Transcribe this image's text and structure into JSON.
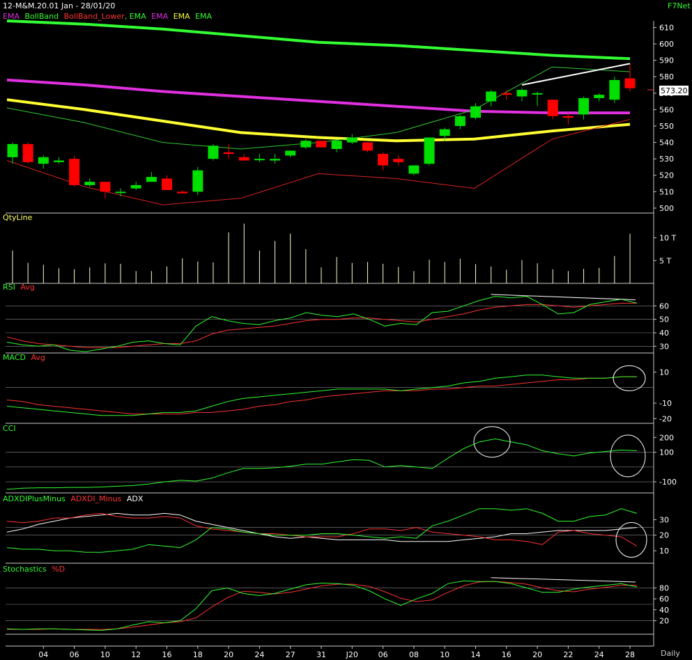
{
  "header": {
    "title": "12-M&M.20.01 Jan - 28/01/20",
    "brand": "F7Net",
    "timeframe": "Daily"
  },
  "colors": {
    "bullish": "#00e000",
    "bearish": "#ff0000",
    "ema_long": "#33ff33",
    "ema_mid": "#e030e0",
    "ema_short": "#ffff33",
    "boll_upper": "#33cc33",
    "boll_lower": "#dd2222",
    "volume": "#ffffcc",
    "grid": "#888888"
  },
  "chart_data": [
    {
      "type": "candlestick",
      "panel": "price",
      "legend": [
        "EMA",
        "BollBand",
        "BollBand_Lower",
        "EMA",
        "EMA",
        "EMA",
        "EMA"
      ],
      "y_ticks": [
        500,
        510,
        520,
        530,
        540,
        550,
        560,
        570,
        580,
        590,
        600,
        610
      ],
      "ylim": [
        497,
        614
      ],
      "last_price": "573.20",
      "x_ticks": [
        "04",
        "06",
        "10",
        "12",
        "16",
        "18",
        "20",
        "24",
        "27",
        "31",
        "J20",
        "06",
        "08",
        "10",
        "14",
        "16",
        "20",
        "22",
        "24",
        "28"
      ],
      "candles": [
        {
          "o": 531,
          "h": 540,
          "l": 527,
          "c": 539
        },
        {
          "o": 539,
          "h": 540,
          "l": 527,
          "c": 528
        },
        {
          "o": 527,
          "h": 532,
          "l": 524,
          "c": 531
        },
        {
          "o": 528,
          "h": 531,
          "l": 527,
          "c": 529
        },
        {
          "o": 530,
          "h": 532,
          "l": 513,
          "c": 514
        },
        {
          "o": 514,
          "h": 518,
          "l": 513,
          "c": 516
        },
        {
          "o": 516,
          "h": 516,
          "l": 506,
          "c": 510
        },
        {
          "o": 510,
          "h": 512,
          "l": 507,
          "c": 510
        },
        {
          "o": 512,
          "h": 516,
          "l": 511,
          "c": 514
        },
        {
          "o": 516,
          "h": 522,
          "l": 516,
          "c": 519
        },
        {
          "o": 518,
          "h": 520,
          "l": 511,
          "c": 511
        },
        {
          "o": 510,
          "h": 511,
          "l": 509,
          "c": 509
        },
        {
          "o": 510,
          "h": 525,
          "l": 508,
          "c": 523
        },
        {
          "o": 530,
          "h": 539,
          "l": 529,
          "c": 538
        },
        {
          "o": 534,
          "h": 539,
          "l": 530,
          "c": 533
        },
        {
          "o": 531,
          "h": 533,
          "l": 529,
          "c": 529
        },
        {
          "o": 530,
          "h": 533,
          "l": 528,
          "c": 530
        },
        {
          "o": 529,
          "h": 533,
          "l": 527,
          "c": 530
        },
        {
          "o": 532,
          "h": 535,
          "l": 531,
          "c": 535
        },
        {
          "o": 537,
          "h": 542,
          "l": 536,
          "c": 541
        },
        {
          "o": 541,
          "h": 541,
          "l": 537,
          "c": 537
        },
        {
          "o": 536,
          "h": 541,
          "l": 534,
          "c": 541
        },
        {
          "o": 540,
          "h": 545,
          "l": 539,
          "c": 543
        },
        {
          "o": 540,
          "h": 540,
          "l": 534,
          "c": 535
        },
        {
          "o": 533,
          "h": 534,
          "l": 523,
          "c": 526
        },
        {
          "o": 530,
          "h": 532,
          "l": 526,
          "c": 528
        },
        {
          "o": 521,
          "h": 526,
          "l": 520,
          "c": 526
        },
        {
          "o": 527,
          "h": 543,
          "l": 526,
          "c": 543
        },
        {
          "o": 544,
          "h": 549,
          "l": 541,
          "c": 548
        },
        {
          "o": 550,
          "h": 557,
          "l": 548,
          "c": 556
        },
        {
          "o": 555,
          "h": 564,
          "l": 554,
          "c": 562
        },
        {
          "o": 565,
          "h": 572,
          "l": 562,
          "c": 571
        },
        {
          "o": 570,
          "h": 572,
          "l": 566,
          "c": 569
        },
        {
          "o": 568,
          "h": 573,
          "l": 565,
          "c": 572
        },
        {
          "o": 570,
          "h": 571,
          "l": 562,
          "c": 570
        },
        {
          "o": 566,
          "h": 566,
          "l": 554,
          "c": 556
        },
        {
          "o": 556,
          "h": 558,
          "l": 551,
          "c": 555
        },
        {
          "o": 557,
          "h": 568,
          "l": 554,
          "c": 567
        },
        {
          "o": 567,
          "h": 570,
          "l": 565,
          "c": 569
        },
        {
          "o": 566,
          "h": 580,
          "l": 564,
          "c": 578
        },
        {
          "o": 579,
          "h": 588,
          "l": 571,
          "c": 573
        }
      ],
      "ema_long": [
        614,
        612,
        609,
        605,
        601,
        599,
        596,
        593,
        591
      ],
      "ema_mid": [
        578,
        575,
        571,
        568,
        565,
        562,
        559,
        558,
        558
      ],
      "ema_short": [
        566,
        560,
        553,
        546,
        543,
        541,
        542,
        547,
        551
      ],
      "boll_upper": [
        561,
        552,
        540,
        536,
        540,
        546,
        560,
        586,
        583
      ],
      "boll_lower": [
        529,
        513,
        502,
        506,
        521,
        518,
        512,
        542,
        554
      ],
      "trendline": {
        "from": 575,
        "to": 588
      }
    },
    {
      "type": "bar",
      "panel": "volume",
      "legend": [
        "QtyLine"
      ],
      "y_ticks": [
        "5 T",
        "10 T"
      ],
      "values": [
        7.2,
        4.5,
        4.1,
        3.3,
        3.1,
        3.5,
        4.4,
        4.3,
        2.7,
        2.7,
        3.7,
        5.5,
        4.8,
        4.6,
        11.2,
        13.1,
        7.2,
        9.3,
        10.9,
        7.5,
        3.5,
        5.8,
        4.5,
        4.7,
        4.3,
        3.6,
        2.7,
        5.2,
        4.7,
        5.4,
        4.2,
        3.7,
        3.0,
        5.1,
        4.4,
        3.1,
        2.7,
        3.2,
        3.4,
        6.0,
        10.9
      ],
      "ylim": [
        0,
        13.3
      ]
    },
    {
      "type": "line",
      "panel": "rsi",
      "legend": [
        "RSI",
        "Avg"
      ],
      "y_ticks": [
        30,
        40,
        50,
        60
      ],
      "ylim": [
        25,
        70
      ],
      "rsi": [
        33,
        31,
        30,
        31,
        27,
        26,
        28,
        30,
        33,
        34,
        32,
        31,
        45,
        52,
        49,
        47,
        46,
        49,
        51,
        55,
        53,
        52,
        54,
        50,
        45,
        47,
        46,
        55,
        56,
        60,
        64,
        67,
        66,
        67,
        61,
        54,
        55,
        61,
        63,
        65,
        62
      ],
      "avg": [
        37,
        34,
        32,
        31,
        30,
        29,
        29,
        29,
        30,
        31,
        32,
        32,
        34,
        39,
        42,
        43,
        44,
        45,
        47,
        49,
        50,
        50,
        51,
        51,
        50,
        49,
        48,
        50,
        52,
        54,
        57,
        59,
        60,
        61,
        61,
        60,
        59,
        60,
        61,
        62,
        62
      ]
    },
    {
      "type": "line",
      "panel": "macd",
      "legend": [
        "MACD",
        "Avg"
      ],
      "y_ticks": [
        -20,
        -10,
        10
      ],
      "ylim": [
        -23,
        16
      ],
      "macd": [
        -12,
        -13,
        -14,
        -15,
        -16,
        -17,
        -18,
        -18,
        -18,
        -17,
        -16,
        -16,
        -15,
        -12,
        -9,
        -7,
        -6,
        -5,
        -4,
        -3,
        -2,
        -1,
        -1,
        -1,
        -1,
        -2,
        -1,
        0,
        1,
        3,
        4,
        6,
        7,
        8,
        8,
        7,
        6,
        6,
        6,
        7,
        7
      ],
      "avg": [
        -8,
        -9,
        -11,
        -12,
        -13,
        -14,
        -15,
        -16,
        -17,
        -17,
        -17,
        -17,
        -16,
        -16,
        -15,
        -14,
        -12,
        -11,
        -9,
        -8,
        -6,
        -5,
        -4,
        -3,
        -2,
        -2,
        -2,
        -1,
        -1,
        0,
        1,
        1,
        2,
        3,
        4,
        5,
        5,
        6,
        6,
        7,
        7
      ]
    },
    {
      "type": "line",
      "panel": "cci",
      "legend": [
        "CCI"
      ],
      "y_ticks": [
        -100,
        100,
        200
      ],
      "ylim": [
        -175,
        225
      ],
      "cci": [
        -150,
        -143,
        -140,
        -140,
        -138,
        -138,
        -135,
        -130,
        -125,
        -115,
        -100,
        -90,
        -95,
        -75,
        -40,
        -10,
        -10,
        -5,
        5,
        20,
        20,
        35,
        50,
        45,
        0,
        10,
        0,
        -10,
        60,
        125,
        170,
        190,
        170,
        150,
        110,
        90,
        75,
        95,
        105,
        115,
        110
      ]
    },
    {
      "type": "line",
      "panel": "adx",
      "legend": [
        "ADXDIPlusMinus",
        "ADXDI_Minus",
        "ADX"
      ],
      "y_ticks": [
        10,
        20,
        30
      ],
      "ylim": [
        2,
        40
      ],
      "di_plus": [
        12,
        11,
        11,
        10,
        10,
        9,
        9,
        10,
        11,
        14,
        13,
        12,
        17,
        25,
        24,
        22,
        21,
        20,
        20,
        20,
        21,
        21,
        20,
        19,
        18,
        19,
        18,
        26,
        29,
        33,
        37,
        37,
        36,
        37,
        34,
        29,
        29,
        32,
        33,
        37,
        34
      ],
      "di_minus": [
        29,
        28,
        29,
        31,
        31,
        33,
        34,
        32,
        31,
        31,
        32,
        31,
        26,
        24,
        23,
        22,
        21,
        21,
        20,
        19,
        19,
        19,
        21,
        24,
        24,
        23,
        25,
        22,
        21,
        20,
        19,
        17,
        17,
        16,
        14,
        22,
        23,
        21,
        20,
        19,
        13
      ],
      "adx": [
        22,
        24,
        27,
        29,
        31,
        32,
        33,
        34,
        33,
        33,
        34,
        33,
        29,
        27,
        25,
        23,
        21,
        19,
        18,
        19,
        18,
        17,
        17,
        17,
        17,
        16,
        16,
        16,
        16,
        17,
        18,
        19,
        21,
        21,
        22,
        23,
        23,
        23,
        23,
        24,
        25
      ]
    },
    {
      "type": "line",
      "panel": "stochastics",
      "legend": [
        "Stochastics",
        "%D"
      ],
      "y_ticks": [
        20,
        40,
        60,
        80
      ],
      "ylim": [
        -5,
        105
      ],
      "k": [
        5,
        4,
        5,
        5,
        4,
        3,
        2,
        5,
        12,
        18,
        16,
        20,
        42,
        75,
        80,
        70,
        66,
        70,
        78,
        86,
        89,
        88,
        85,
        75,
        60,
        48,
        60,
        70,
        88,
        93,
        92,
        92,
        88,
        80,
        72,
        72,
        78,
        82,
        85,
        88,
        82
      ],
      "d": [
        4,
        4,
        4,
        5,
        4,
        4,
        4,
        5,
        8,
        12,
        16,
        18,
        25,
        45,
        62,
        74,
        72,
        69,
        72,
        78,
        84,
        87,
        87,
        83,
        73,
        61,
        55,
        58,
        72,
        84,
        91,
        92,
        90,
        87,
        80,
        75,
        73,
        78,
        81,
        85,
        85
      ]
    }
  ]
}
